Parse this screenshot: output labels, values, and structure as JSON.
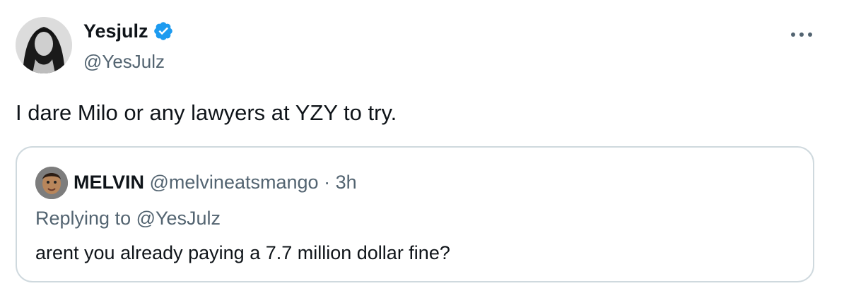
{
  "tweet": {
    "display_name": "Yesjulz",
    "handle": "@YesJulz",
    "verified_icon": "verified-badge-icon",
    "more_icon": "more-dots-icon",
    "text": "I dare Milo or any lawyers at YZY to try."
  },
  "quoted": {
    "display_name": "MELVIN",
    "handle": "@melvineatsmango",
    "separator": "·",
    "time": "3h",
    "replying_to": "Replying to @YesJulz",
    "text": "arent you already paying a 7.7 million dollar fine?"
  },
  "colors": {
    "text_primary": "#0f1419",
    "text_secondary": "#536471",
    "verified_blue": "#1d9bf0",
    "border": "#cfd9de"
  }
}
